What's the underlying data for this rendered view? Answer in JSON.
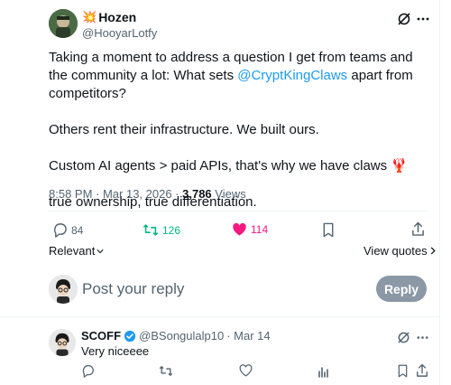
{
  "post": {
    "author_name": "Hozen",
    "author_emoji": "💥",
    "author_handle": "@HooyarLotfy",
    "paragraphs": [
      {
        "pre": "Taking a moment to address a question I get from teams and the community a lot: What sets ",
        "link": "@CryptKingClaws",
        "post": "  apart from competitors?"
      },
      {
        "pre": "Others rent their infrastructure. We built ours.",
        "link": "",
        "post": ""
      },
      {
        "pre": "Custom AI agents > paid APIs, that's why we have claws ",
        "link": "",
        "post": "🦞"
      },
      {
        "pre": "true ownership, true differentiation.",
        "link": "",
        "post": ""
      }
    ],
    "timestamp": "8:58 PM · Mar 13, 2026 · ",
    "views_count": "3,786",
    "views_label": " Views",
    "stats": {
      "replies": "84",
      "reposts": "126",
      "likes": "114"
    },
    "relevant_label": "Relevant",
    "view_quotes_label": "View quotes",
    "colors": {
      "repost": "#00ba7c",
      "like": "#f91880",
      "link": "#1d9bf0"
    }
  },
  "composer": {
    "placeholder": "Post your reply",
    "reply_button": "Reply"
  },
  "reply": {
    "author_name": "SCOFF",
    "author_handle": "@BSongulalp10",
    "date": " · Mar 14",
    "text": "Very niceeee"
  }
}
